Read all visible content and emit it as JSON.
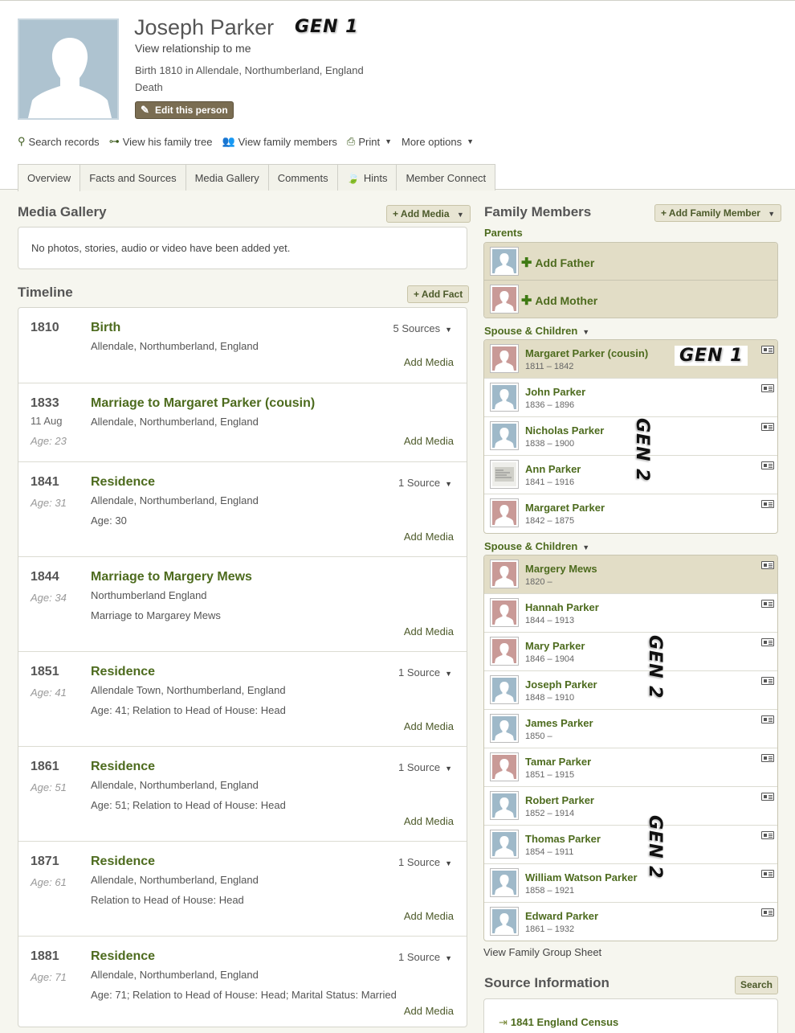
{
  "person": {
    "name": "Joseph Parker",
    "gen_label": "GEN 1",
    "view_relationship": "View relationship to me",
    "birth": "Birth 1810 in Allendale, Northumberland, England",
    "death": "Death",
    "edit_button": "Edit this person"
  },
  "actions": [
    {
      "label": "Search records",
      "icon": "search-icon"
    },
    {
      "label": "View his family tree",
      "icon": "tree-icon"
    },
    {
      "label": "View family members",
      "icon": "people-icon"
    },
    {
      "label": "Print",
      "icon": "print-icon"
    },
    {
      "label": "More options",
      "icon": "chevron-down-icon"
    }
  ],
  "tabs": [
    "Overview",
    "Facts and Sources",
    "Media Gallery",
    "Comments",
    "Hints",
    "Member Connect"
  ],
  "media_gallery": {
    "title": "Media Gallery",
    "add_button": "+ Add Media",
    "empty_text": "No photos, stories, audio or video have been added yet."
  },
  "timeline": {
    "title": "Timeline",
    "add_button": "+ Add Fact",
    "add_media_label": "Add Media",
    "events": [
      {
        "year": "1810",
        "date": "",
        "age": "",
        "title": "Birth",
        "place": "Allendale, Northumberland, England",
        "desc": "",
        "sources": "5 Sources"
      },
      {
        "year": "1833",
        "date": "11 Aug",
        "age": "Age: 23",
        "title": "Marriage to Margaret Parker (cousin)",
        "place": "Allendale, Northumberland, England",
        "desc": "",
        "sources": ""
      },
      {
        "year": "1841",
        "date": "",
        "age": "Age: 31",
        "title": "Residence",
        "place": "Allendale, Northumberland, England",
        "desc": "Age: 30",
        "sources": "1 Source"
      },
      {
        "year": "1844",
        "date": "",
        "age": "Age: 34",
        "title": "Marriage to Margery Mews",
        "place": "Northumberland England",
        "desc": "Marriage to Margarey Mews",
        "sources": ""
      },
      {
        "year": "1851",
        "date": "",
        "age": "Age: 41",
        "title": "Residence",
        "place": "Allendale Town, Northumberland, England",
        "desc": "Age: 41; Relation to Head of House: Head",
        "sources": "1 Source"
      },
      {
        "year": "1861",
        "date": "",
        "age": "Age: 51",
        "title": "Residence",
        "place": "Allendale, Northumberland, England",
        "desc": "Age: 51; Relation to Head of House: Head",
        "sources": "1 Source"
      },
      {
        "year": "1871",
        "date": "",
        "age": "Age: 61",
        "title": "Residence",
        "place": "Allendale, Northumberland, England",
        "desc": "Relation to Head of House: Head",
        "sources": "1 Source"
      },
      {
        "year": "1881",
        "date": "",
        "age": "Age: 71",
        "title": "Residence",
        "place": "Allendale, Northumberland, England",
        "desc": "Age: 71; Relation to Head of House: Head; Marital Status: Married",
        "sources": "1 Source"
      }
    ]
  },
  "family": {
    "title": "Family Members",
    "add_button": "+ Add Family Member",
    "parents_label": "Parents",
    "add_father": "Add Father",
    "add_mother": "Add Mother",
    "spouse_label": "Spouse & Children",
    "gen1": "GEN 1",
    "gen2": "GEN 2",
    "spouse1": {
      "name": "Margaret Parker (cousin)",
      "dates": "1811 – 1842"
    },
    "children1": [
      {
        "name": "John Parker",
        "dates": "1836 – 1896",
        "sex": "male"
      },
      {
        "name": "Nicholas Parker",
        "dates": "1838 – 1900",
        "sex": "male"
      },
      {
        "name": "Ann Parker",
        "dates": "1841 – 1916",
        "sex": "photo"
      },
      {
        "name": "Margaret Parker",
        "dates": "1842 – 1875",
        "sex": "female"
      }
    ],
    "spouse2": {
      "name": "Margery Mews",
      "dates": "1820 –"
    },
    "children2": [
      {
        "name": "Hannah Parker",
        "dates": "1844 – 1913",
        "sex": "female"
      },
      {
        "name": "Mary Parker",
        "dates": "1846 – 1904",
        "sex": "female"
      },
      {
        "name": "Joseph Parker",
        "dates": "1848 – 1910",
        "sex": "male"
      },
      {
        "name": "James Parker",
        "dates": "1850 –",
        "sex": "male"
      },
      {
        "name": "Tamar Parker",
        "dates": "1851 – 1915",
        "sex": "female"
      },
      {
        "name": "Robert Parker",
        "dates": "1852 – 1914",
        "sex": "male"
      },
      {
        "name": "Thomas Parker",
        "dates": "1854 – 1911",
        "sex": "male"
      },
      {
        "name": "William Watson Parker",
        "dates": "1858 – 1921",
        "sex": "male"
      },
      {
        "name": "Edward Parker",
        "dates": "1861 – 1932",
        "sex": "male"
      }
    ],
    "group_sheet_link": "View Family Group Sheet"
  },
  "sources": {
    "title": "Source Information",
    "search_button": "Search",
    "items": [
      "1841 England Census"
    ]
  },
  "colors": {
    "accent_green": "#4d6b1e",
    "highlight": "#e2ddc6",
    "male_avatar": "#9fb9c9",
    "female_avatar": "#c99a97"
  }
}
